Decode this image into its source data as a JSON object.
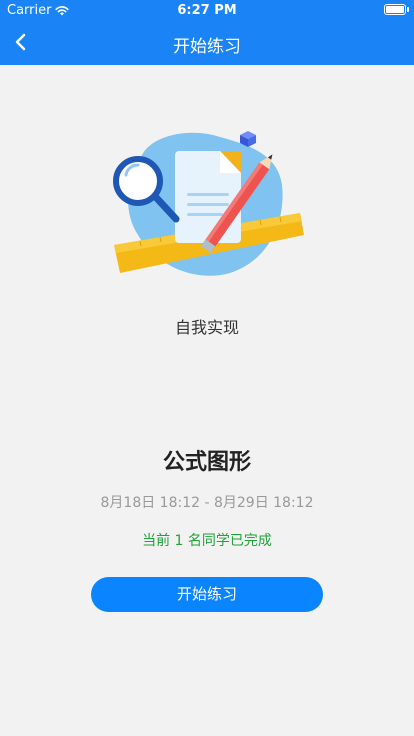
{
  "status_bar": {
    "carrier": "Carrier",
    "time": "6:27 PM",
    "battery_level": 1.0
  },
  "nav": {
    "title": "开始练习",
    "back_icon": "chevron-left-icon"
  },
  "content": {
    "subtitle": "自我实现",
    "title": "公式图形",
    "date_range": "8月18日 18:12 - 8月29日 18:12",
    "completed_text": "当前 1 名同学已完成",
    "start_button_label": "开始练习"
  },
  "colors": {
    "header_bg": "#1a84f7",
    "button_bg": "#0a84ff",
    "completed_text": "#1fa33a",
    "date_text": "#999999",
    "page_bg": "#f2f2f2"
  }
}
